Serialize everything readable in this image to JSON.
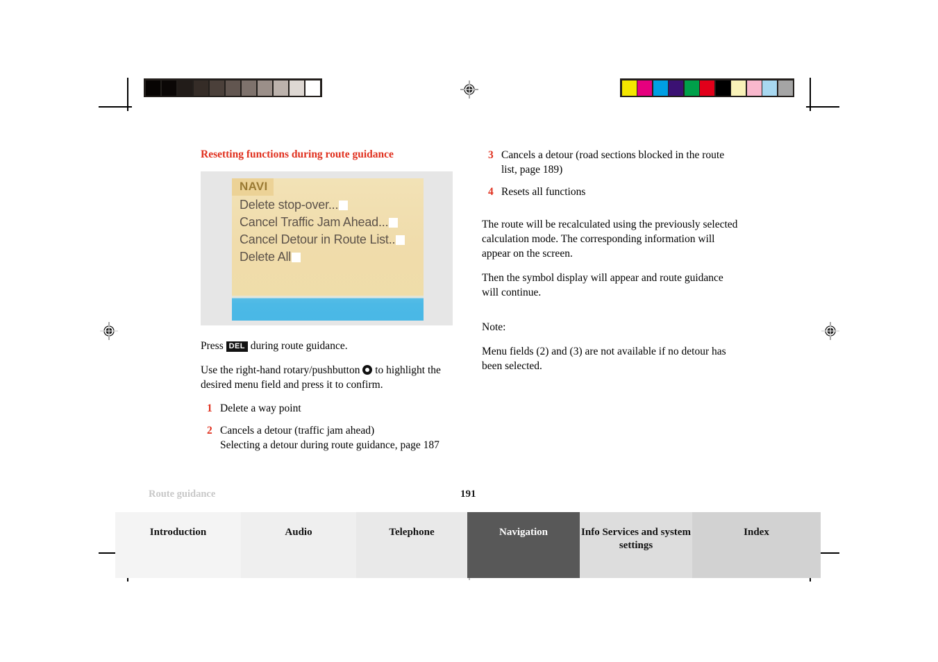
{
  "document": {
    "section_title": "Resetting functions during route guidance",
    "running_head": "Route guidance",
    "page_number": "191"
  },
  "figure": {
    "name": "navigation-display-screenshot",
    "screen_header": "NAVI",
    "menu_items": [
      {
        "label": "Delete stop-over..."
      },
      {
        "label": "Cancel Traffic Jam Ahead..."
      },
      {
        "label": "Cancel Detour in Route List.."
      },
      {
        "label": "Delete All"
      }
    ],
    "colors": {
      "screen_background": "#f0dcab",
      "header_band": "#ecd296",
      "header_text": "#9a7a33",
      "menu_text": "#5c5249",
      "status_bar": "#4cb9e6",
      "figure_frame": "#e6e6e6"
    }
  },
  "left_column": {
    "press_line": {
      "before": "Press",
      "keycap": "DEL",
      "after": "during route guidance."
    },
    "rotary_line": {
      "before": "Use the right-hand rotary/pushbutton",
      "after": "to highlight the desired menu field and press it to confirm."
    },
    "items": [
      {
        "num": "1",
        "text": "Delete a way point",
        "sub": ""
      },
      {
        "num": "2",
        "text": "Cancels a detour (traffic jam ahead)",
        "sub": "Selecting a detour during route guidance, page 187"
      }
    ]
  },
  "right_column": {
    "items": [
      {
        "num": "3",
        "text": "Cancels a detour (road sections blocked in the route list, page 189)"
      },
      {
        "num": "4",
        "text": "Resets all functions"
      }
    ],
    "paragraphs": [
      "The route will be recalculated using the previously selected calculation mode. The corresponding information will appear on the screen.",
      "Then the symbol display will appear and route guidance will continue."
    ],
    "note_label": "Note:",
    "note_text": "Menu fields (2) and (3) are not available if no detour has been selected."
  },
  "tabs": [
    {
      "label": "Introduction",
      "active": false
    },
    {
      "label": "Audio",
      "active": false
    },
    {
      "label": "Telephone",
      "active": false
    },
    {
      "label": "Navigation",
      "active": true
    },
    {
      "label": "Info Services and system settings",
      "active": false
    },
    {
      "label": "Index",
      "active": false
    }
  ],
  "print_marks": {
    "grayscale_bar": [
      "#070403",
      "#0b0706",
      "#221c19",
      "#352c27",
      "#4b403a",
      "#625650",
      "#7e726c",
      "#9b8f89",
      "#bcb2ac",
      "#ded8d3",
      "#ffffff"
    ],
    "color_bar": [
      "#f4e600",
      "#e6007e",
      "#009fe3",
      "#3b1173",
      "#00a04a",
      "#e2001a",
      "#000000",
      "#f9f2b8",
      "#f9b8cd",
      "#a8d8f0",
      "#a5a5a5"
    ]
  },
  "accent_colors": {
    "heading_red": "#e0301e",
    "number_red": "#e0301e",
    "tab_active_bg": "#585858"
  }
}
